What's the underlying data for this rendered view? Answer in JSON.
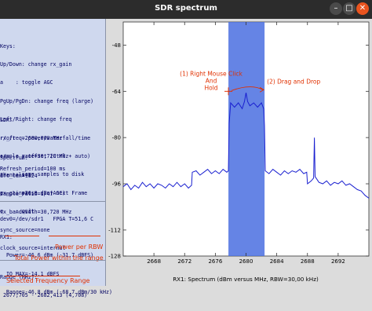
{
  "window": {
    "title": "SDR spectrum",
    "minimize_glyph": "–",
    "maximize_glyph": "□",
    "close_glyph": "✕"
  },
  "left_panel": {
    "keys_lines": [
      "Keys:",
      "Up/Down: change rx_gain",
      "a    : toggle AGC",
      "PgUp/PgDn: change freq (large)",
      "Left/Right: change freq",
      "r/o/t  : power/waterfall/time",
      "+/-  : y-offset (Ctrl + auto)",
      "s    : save samples to disk",
      "p    : pause   n: next Frame",
      "q    : quit"
    ],
    "sdr_lines": [
      "SDR:",
      "rx_freq=2680,000 MHz",
      "sample_rate=30,720 MHz",
      "channels=1",
      "rx_gain=26,0 dB (AGC)",
      "rx_bandwidth=30,720 MHz",
      "sync_source=none",
      "clock_source=internal"
    ],
    "spectrum_lines": [
      "Spectrum:",
      "dft_len=1024",
      "sample_ratio=1/47"
    ],
    "refresh_line": "Refresh_period=100 ms",
    "device_lines": [
      "dev0=/dev/sdr1   FPGA T=51,6 C",
      "RX1:",
      "  Power=-46,6 dBm (-31,7 dBFS)",
      "  IQ MAX=-14,1 dBFS",
      "  Range=-46,8 dBm (-68,7 dBm/30 kHz)"
    ],
    "range_lines": [
      "Range (MHz):",
      " 2677,705 - 2682,413 (4,708)"
    ]
  },
  "annotations": {
    "power_per_rbw": "Power per RBW",
    "total_power": "Total Power within the range",
    "selected_range": "Selected Frequency Range",
    "right_click": [
      "(1) Right Mouse Click",
      "And",
      "Hold"
    ],
    "drag_drop": "(2) Drag and Drop"
  },
  "colors": {
    "trace": "#1a20d0",
    "selection": "#4a6fe0",
    "annotation": "#e03000",
    "panel": "#cfd8ee",
    "plot_bg": "#ffffff"
  },
  "chart_data": {
    "type": "line",
    "title": "",
    "xlabel": "RX1: Spectrum (dBm versus MHz, RBW=30,00 kHz)",
    "ylabel": "",
    "xlim": [
      2664,
      2696
    ],
    "ylim": [
      -121,
      -40
    ],
    "xticks": [
      2668,
      2672,
      2676,
      2680,
      2684,
      2688,
      2692
    ],
    "yticks": [
      -48,
      -64,
      -80,
      -96,
      -112,
      -128
    ],
    "selection_mhz": [
      2677.705,
      2682.413
    ],
    "series": [
      {
        "points": [
          [
            2664.0,
            -97.0
          ],
          [
            2664.5,
            -96.0
          ],
          [
            2665.0,
            -98.0
          ],
          [
            2665.5,
            -96.5
          ],
          [
            2666.0,
            -97.5
          ],
          [
            2666.5,
            -95.5
          ],
          [
            2667.0,
            -97.0
          ],
          [
            2667.5,
            -96.0
          ],
          [
            2668.0,
            -97.5
          ],
          [
            2668.5,
            -96.0
          ],
          [
            2669.0,
            -96.5
          ],
          [
            2669.5,
            -97.5
          ],
          [
            2670.0,
            -96.0
          ],
          [
            2670.5,
            -97.0
          ],
          [
            2671.0,
            -95.5
          ],
          [
            2671.5,
            -97.0
          ],
          [
            2672.0,
            -96.0
          ],
          [
            2672.5,
            -97.5
          ],
          [
            2672.9,
            -96.5
          ],
          [
            2673.0,
            -92.0
          ],
          [
            2673.5,
            -91.5
          ],
          [
            2674.0,
            -93.0
          ],
          [
            2674.5,
            -92.0
          ],
          [
            2675.0,
            -91.0
          ],
          [
            2675.5,
            -92.5
          ],
          [
            2676.0,
            -91.5
          ],
          [
            2676.5,
            -92.5
          ],
          [
            2677.0,
            -91.0
          ],
          [
            2677.5,
            -92.0
          ],
          [
            2677.7,
            -91.5
          ],
          [
            2677.8,
            -75.0
          ],
          [
            2678.0,
            -68.0
          ],
          [
            2678.5,
            -69.5
          ],
          [
            2679.0,
            -68.0
          ],
          [
            2679.5,
            -70.0
          ],
          [
            2679.8,
            -67.5
          ],
          [
            2680.0,
            -64.5
          ],
          [
            2680.2,
            -67.5
          ],
          [
            2680.5,
            -69.0
          ],
          [
            2681.0,
            -68.0
          ],
          [
            2681.5,
            -69.5
          ],
          [
            2682.0,
            -68.0
          ],
          [
            2682.3,
            -70.0
          ],
          [
            2682.4,
            -76.0
          ],
          [
            2682.5,
            -91.5
          ],
          [
            2683.0,
            -92.5
          ],
          [
            2683.5,
            -91.0
          ],
          [
            2684.0,
            -92.0
          ],
          [
            2684.5,
            -93.0
          ],
          [
            2685.0,
            -91.5
          ],
          [
            2685.5,
            -92.5
          ],
          [
            2686.0,
            -91.5
          ],
          [
            2686.5,
            -92.0
          ],
          [
            2687.0,
            -91.0
          ],
          [
            2687.5,
            -92.5
          ],
          [
            2687.9,
            -92.0
          ],
          [
            2688.0,
            -96.0
          ],
          [
            2688.5,
            -95.0
          ],
          [
            2688.8,
            -94.0
          ],
          [
            2688.9,
            -80.0
          ],
          [
            2689.0,
            -93.5
          ],
          [
            2689.5,
            -95.5
          ],
          [
            2690.0,
            -96.0
          ],
          [
            2690.5,
            -95.0
          ],
          [
            2691.0,
            -96.5
          ],
          [
            2691.5,
            -95.5
          ],
          [
            2692.0,
            -96.0
          ],
          [
            2692.5,
            -95.0
          ],
          [
            2693.0,
            -96.5
          ],
          [
            2693.5,
            -96.0
          ],
          [
            2694.0,
            -97.0
          ],
          [
            2694.5,
            -98.0
          ],
          [
            2695.0,
            -98.5
          ],
          [
            2695.5,
            -100.0
          ],
          [
            2696.0,
            -101.0
          ]
        ]
      }
    ]
  }
}
